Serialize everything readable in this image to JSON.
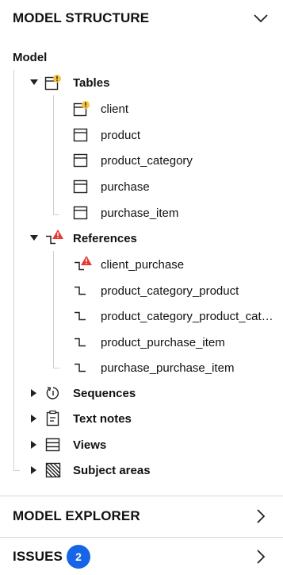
{
  "colors": {
    "warning": "#f5c542",
    "error": "#e53935",
    "badge": "#1565e6",
    "tree_line": "#d0d0d0"
  },
  "model_structure": {
    "title": "MODEL STRUCTURE"
  },
  "model": {
    "label": "Model"
  },
  "tables": {
    "label": "Tables",
    "icon": "table-warning-icon",
    "items": [
      {
        "label": "client",
        "icon": "table-warning-icon"
      },
      {
        "label": "product",
        "icon": "table-icon"
      },
      {
        "label": "product_category",
        "icon": "table-icon"
      },
      {
        "label": "purchase",
        "icon": "table-icon"
      },
      {
        "label": "purchase_item",
        "icon": "table-icon"
      }
    ]
  },
  "references": {
    "label": "References",
    "icon": "reference-error-icon",
    "items": [
      {
        "label": "client_purchase",
        "icon": "reference-error-icon"
      },
      {
        "label": "product_category_product",
        "icon": "reference-icon"
      },
      {
        "label": "product_category_product_cat…",
        "icon": "reference-icon"
      },
      {
        "label": "product_purchase_item",
        "icon": "reference-icon"
      },
      {
        "label": "purchase_purchase_item",
        "icon": "reference-icon"
      }
    ]
  },
  "sequences": {
    "label": "Sequences",
    "icon": "sequence-icon"
  },
  "text_notes": {
    "label": "Text notes",
    "icon": "text-note-icon"
  },
  "views": {
    "label": "Views",
    "icon": "view-icon"
  },
  "subject_areas": {
    "label": "Subject areas",
    "icon": "subject-area-icon"
  },
  "model_explorer": {
    "title": "MODEL EXPLORER"
  },
  "issues": {
    "title": "ISSUES",
    "count": "2"
  }
}
